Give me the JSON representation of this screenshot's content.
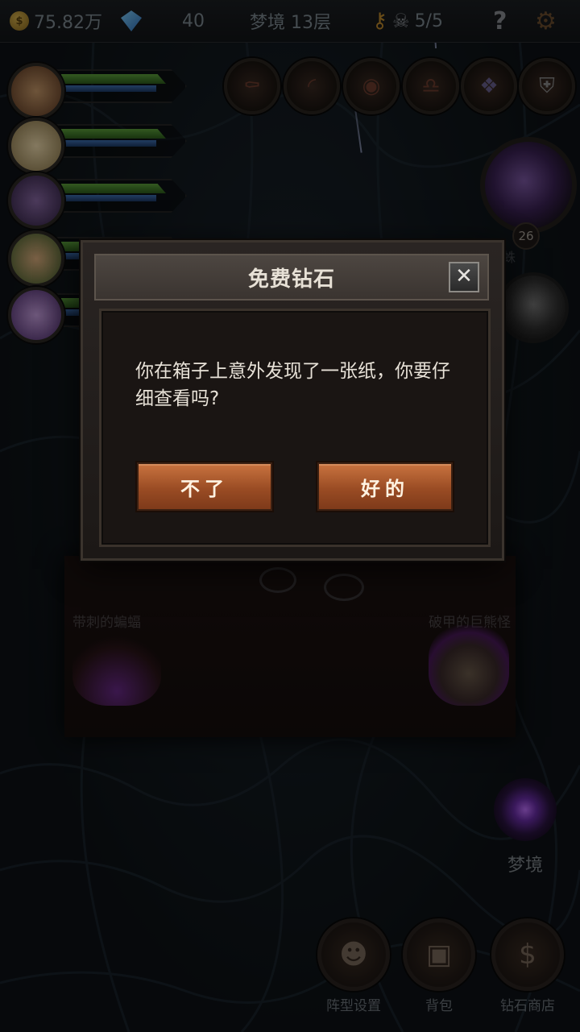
{
  "topbar": {
    "gold_icon": "coin-icon",
    "gold_value": "75.82万",
    "gem_icon": "diamond-icon",
    "gem_value": "40",
    "floor_label": "梦境 13层",
    "key_icon": "key-icon",
    "skull_icon": "skull-icon",
    "lives": "5/5",
    "help_icon": "question-icon",
    "settings_icon": "gear-icon"
  },
  "heroes": [
    {
      "name": "hero-1",
      "color": "#8b5a3c"
    },
    {
      "name": "hero-2",
      "color": "#c9b37a"
    },
    {
      "name": "hero-3",
      "color": "#5b4a7a"
    },
    {
      "name": "hero-4",
      "color": "#4c7a3a"
    },
    {
      "name": "hero-5",
      "color": "#7a4c9a"
    }
  ],
  "skills": [
    "coffin-icon",
    "horn-icon",
    "eye-icon",
    "bell-icon",
    "dragon-icon",
    "helmet-icon"
  ],
  "boss": {
    "level": "26",
    "side_text": "蛛"
  },
  "encounter": {
    "left_monster": "带刺的蝙蝠",
    "right_monster": "破甲的巨熊怪"
  },
  "modal": {
    "title": "免费钻石",
    "message": "你在箱子上意外发现了一张纸，你要仔细查看吗?",
    "close_icon": "close-icon",
    "no_label": "不了",
    "yes_label": "好的"
  },
  "dream": {
    "label": "梦境"
  },
  "bottom_menu": [
    {
      "icon": "formation-icon",
      "label": "阵型设置"
    },
    {
      "icon": "backpack-icon",
      "label": "背包"
    },
    {
      "icon": "dollar-icon",
      "label": "钻石商店"
    }
  ],
  "colors": {
    "button": "#b05e30",
    "modal_bg": "#1c1816",
    "accent_text": "#e8e2d8"
  }
}
